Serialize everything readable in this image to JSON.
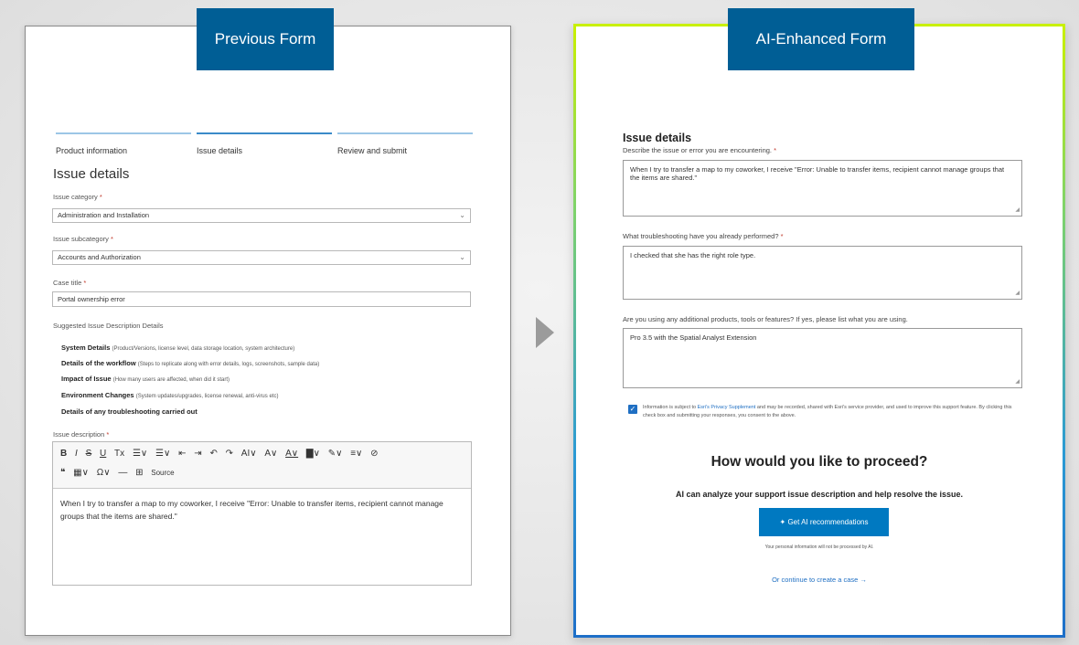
{
  "left_form": {
    "tab_label": "Previous Form",
    "steps": [
      "Product information",
      "Issue details",
      "Review and submit"
    ],
    "title": "Issue details",
    "fields": {
      "issue_category": {
        "label": "Issue category",
        "value": "Administration and Installation"
      },
      "issue_subcategory": {
        "label": "Issue subcategory",
        "value": "Accounts and Authorization"
      },
      "case_title": {
        "label": "Case title",
        "value": "Portal ownership error"
      }
    },
    "required_marker": "*",
    "suggested": {
      "title": "Suggested Issue Description Details",
      "items": [
        {
          "label": "System Details",
          "hint": "(Product/Versions, license level, data storage location, system architecture)"
        },
        {
          "label": "Details of the workflow",
          "hint": "(Steps to replicate along with error details, logs, screenshots, sample data)"
        },
        {
          "label": "Impact of Issue",
          "hint": "(How many users are affected, when did it start)"
        },
        {
          "label": "Environment Changes",
          "hint": "(System updates/upgrades, license renewal, anti-virus etc)"
        },
        {
          "label": "Details of any troubleshooting carried out",
          "hint": ""
        }
      ]
    },
    "description": {
      "label": "Issue description",
      "toolbar_row1": [
        "B",
        "I",
        "S",
        "U",
        "Tx",
        "☰∨",
        "☰∨",
        "⇤",
        "⇥",
        "↶",
        "↷",
        "AI∨",
        "A∨",
        "A∨",
        "▇∨",
        "✎∨",
        "≡∨",
        "⊘"
      ],
      "toolbar_row2": [
        "❝",
        "▦∨",
        "Ω∨",
        "—",
        "⊞",
        "Source"
      ],
      "text": "When I try to transfer a map to my coworker, I receive \"Error: Unable to transfer items, recipient cannot manage groups that the items are shared.\""
    }
  },
  "right_form": {
    "tab_label": "AI-Enhanced Form",
    "title": "Issue details",
    "questions": [
      {
        "label": "Describe the issue or error you are encountering.",
        "required": true,
        "answer": "When I try to transfer a map to my coworker, I receive \"Error: Unable to transfer items, recipient cannot manage groups that the items are shared.\""
      },
      {
        "label": "What troubleshooting have you already performed?",
        "required": true,
        "answer": "I checked that she has the right role type."
      },
      {
        "label": "Are you using any additional products, tools or features? If yes, please list what you are using.",
        "required": false,
        "answer": "Pro 3.5 with the Spatial Analyst Extension"
      }
    ],
    "consent": {
      "checked": true,
      "text_before": "Information is subject to ",
      "link": "Esri's Privacy Supplement",
      "text_after": " and may be recorded, shared with Esri's service provider, and used to improve this support feature. By clicking this check box and submitting your responses, you consent to the above."
    },
    "proceed_title": "How would you like to proceed?",
    "proceed_subtitle": "AI can analyze your support issue description and help resolve the issue.",
    "ai_button": "Get AI recommendations",
    "ai_note": "Your personal information will not be processed by AI.",
    "continue_link": "Or continue to create a case →"
  },
  "colors": {
    "tab_bg": "#005e95",
    "button_bg": "#0079c1",
    "link": "#1f6fc3",
    "gradient_top": "#c9f000",
    "gradient_bottom": "#1e6fc8"
  }
}
